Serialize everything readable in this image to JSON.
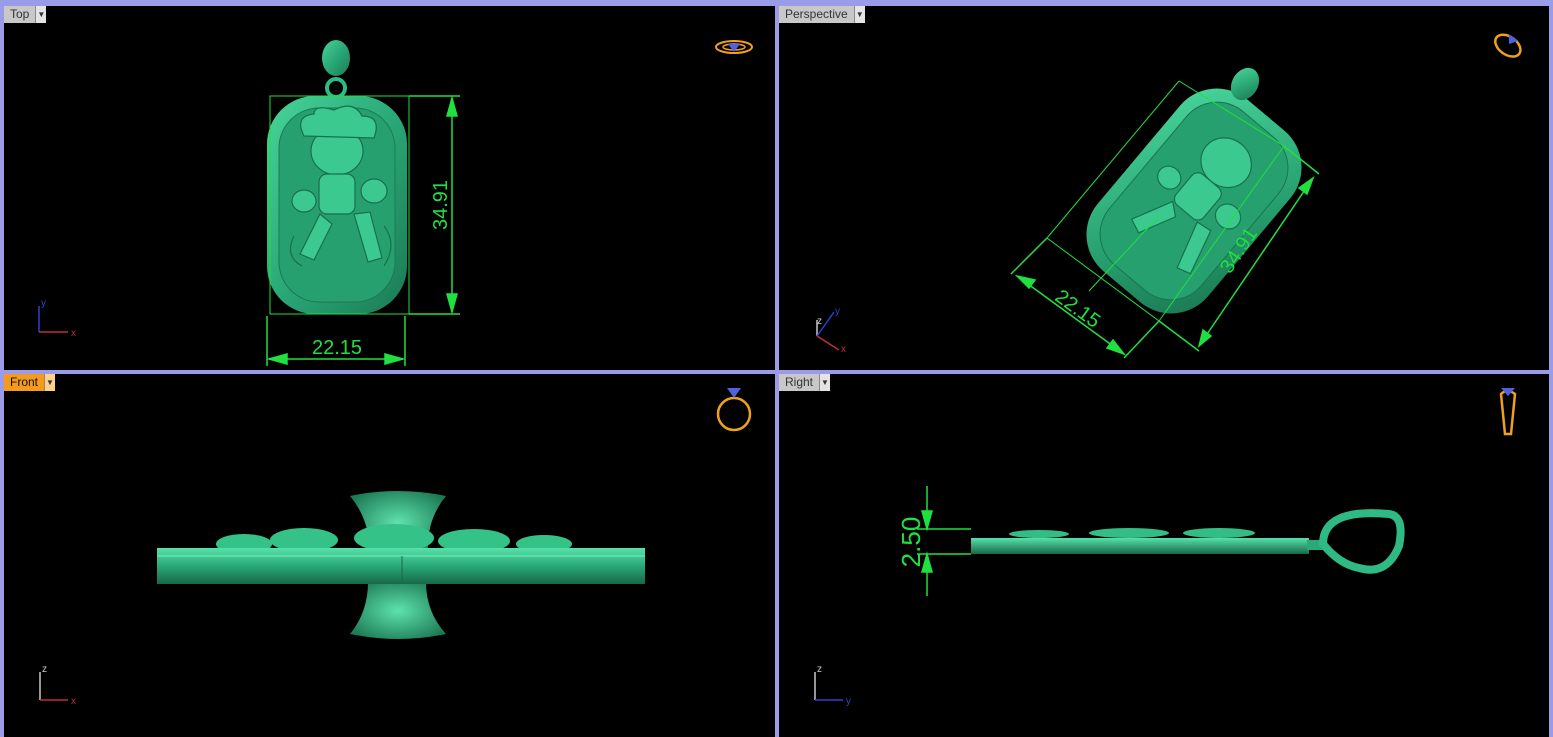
{
  "viewports": {
    "top": {
      "label": "Top",
      "dimensions": {
        "height": "34.91",
        "width": "22.15"
      },
      "axis_x": "x",
      "axis_y": "y"
    },
    "perspective": {
      "label": "Perspective",
      "dimensions": {
        "height": "34.91",
        "width": "22.15"
      },
      "axis_x": "x",
      "axis_y": "y",
      "axis_z": "z"
    },
    "front": {
      "label": "Front",
      "active": true,
      "axis_x": "x",
      "axis_z": "z"
    },
    "right": {
      "label": "Right",
      "dimensions": {
        "thickness": "2.50"
      },
      "axis_y": "y",
      "axis_z": "z"
    }
  },
  "colors": {
    "frame": "#9a9ce8",
    "viewport_bg": "#000000",
    "model": "#2fb985",
    "dimension": "#20e040",
    "active_tab": "#f59a1c",
    "icon": "#f0a020",
    "axis_x": "#c03030",
    "axis_y": "#3040d0",
    "axis_z": "#c8c8c8"
  },
  "icons": {
    "top": "ring-top-view-icon",
    "perspective": "ring-perspective-view-icon",
    "front": "ring-front-view-icon",
    "right": "ring-side-view-icon"
  }
}
